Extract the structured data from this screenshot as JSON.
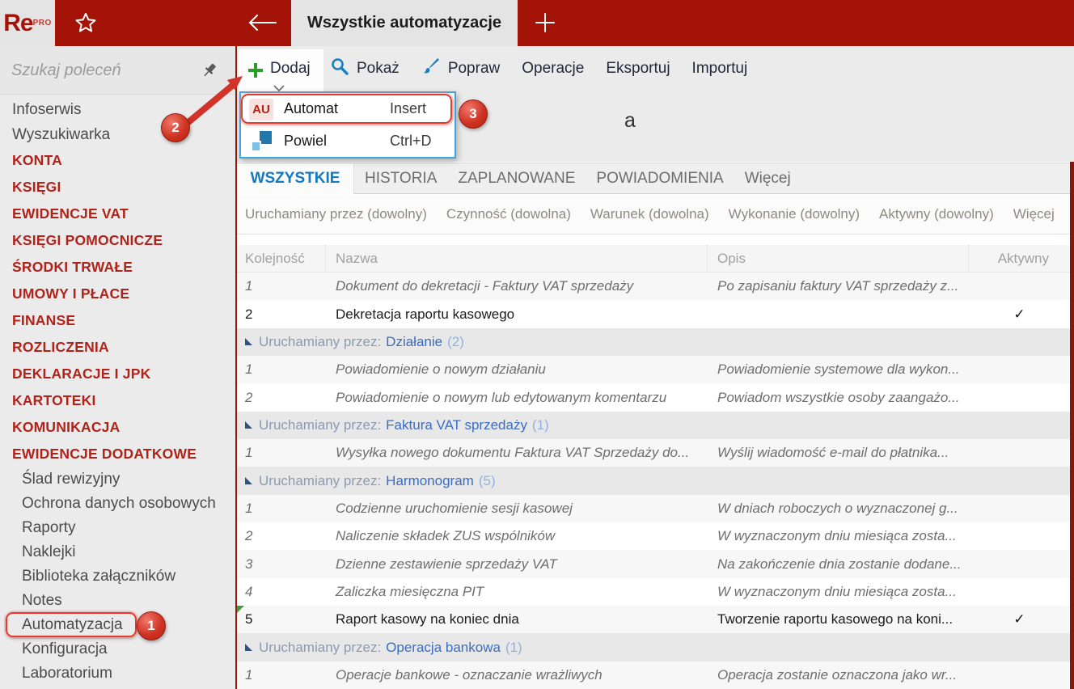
{
  "topbar": {
    "logo": "Re",
    "logo_sup": "PRO",
    "tab_title": "Wszystkie automatyzacje"
  },
  "sidebar": {
    "search_placeholder": "Szukaj poleceń",
    "items": [
      {
        "label": "Infoserwis",
        "type": "plain"
      },
      {
        "label": "Wyszukiwarka",
        "type": "plain"
      },
      {
        "label": "KONTA",
        "type": "section"
      },
      {
        "label": "KSIĘGI",
        "type": "section"
      },
      {
        "label": "EWIDENCJE VAT",
        "type": "section"
      },
      {
        "label": "KSIĘGI POMOCNICZE",
        "type": "section"
      },
      {
        "label": "ŚRODKI TRWAŁE",
        "type": "section"
      },
      {
        "label": "UMOWY I PŁACE",
        "type": "section"
      },
      {
        "label": "FINANSE",
        "type": "section"
      },
      {
        "label": "ROZLICZENIA",
        "type": "section"
      },
      {
        "label": "DEKLARACJE I JPK",
        "type": "section"
      },
      {
        "label": "KARTOTEKI",
        "type": "section"
      },
      {
        "label": "KOMUNIKACJA",
        "type": "section"
      },
      {
        "label": "EWIDENCJE DODATKOWE",
        "type": "section"
      },
      {
        "label": "Ślad rewizyjny",
        "type": "sub"
      },
      {
        "label": "Ochrona danych osobowych",
        "type": "sub"
      },
      {
        "label": "Raporty",
        "type": "sub"
      },
      {
        "label": "Naklejki",
        "type": "sub"
      },
      {
        "label": "Biblioteka załączników",
        "type": "sub"
      },
      {
        "label": "Notes",
        "type": "sub"
      },
      {
        "label": "Automatyzacja",
        "type": "sub"
      },
      {
        "label": "Konfiguracja",
        "type": "sub"
      },
      {
        "label": "Laboratorium",
        "type": "sub"
      }
    ]
  },
  "toolbar": {
    "add_label": "Dodaj",
    "show_label": "Pokaż",
    "edit_label": "Popraw",
    "operations_label": "Operacje",
    "export_label": "Eksportuj",
    "import_label": "Importuj"
  },
  "dropdown": {
    "items": [
      {
        "icon_text": "AU",
        "label": "Automat",
        "shortcut": "Insert"
      },
      {
        "icon_text": "",
        "label": "Powiel",
        "shortcut": "Ctrl+D"
      }
    ]
  },
  "partial_title": "a",
  "tabs": [
    "WSZYSTKIE",
    "HISTORIA",
    "ZAPLANOWANE",
    "POWIADOMIENIA",
    "Więcej"
  ],
  "filters": [
    "Uruchamiany przez (dowolny)",
    "Czynność (dowolna)",
    "Warunek (dowolna)",
    "Wykonanie (dowolny)",
    "Aktywny (dowolny)",
    "Więcej"
  ],
  "table": {
    "columns": [
      "Kolejność",
      "Nazwa",
      "Opis",
      "Aktywny"
    ],
    "rows": [
      {
        "type": "row",
        "seq": 1,
        "name": "Dokument do dekretacji - Faktury VAT sprzedaży",
        "desc": "Po zapisaniu faktury VAT sprzedaży z...",
        "active": "",
        "italic": true
      },
      {
        "type": "row",
        "seq": 2,
        "name": "Dekretacja raportu kasowego",
        "desc": "",
        "active": "✓",
        "italic": false
      },
      {
        "type": "group",
        "label": "Uruchamiany przez:",
        "value": "Działanie",
        "count": "(2)"
      },
      {
        "type": "row",
        "seq": 1,
        "name": "Powiadomienie o nowym działaniu",
        "desc": "Powiadomienie systemowe dla wykon...",
        "active": "",
        "italic": true
      },
      {
        "type": "row",
        "seq": 2,
        "name": "Powiadomienie o nowym lub edytowanym komentarzu",
        "desc": "Powiadom wszystkie osoby zaangażo...",
        "active": "",
        "italic": true
      },
      {
        "type": "group",
        "label": "Uruchamiany przez:",
        "value": "Faktura VAT sprzedaży",
        "count": "(1)"
      },
      {
        "type": "row",
        "seq": 1,
        "name": "Wysyłka nowego dokumentu Faktura VAT Sprzedaży do...",
        "desc": "Wyślij wiadomość e-mail do płatnika...",
        "active": "",
        "italic": true
      },
      {
        "type": "group",
        "label": "Uruchamiany przez:",
        "value": "Harmonogram",
        "count": "(5)"
      },
      {
        "type": "row",
        "seq": 1,
        "name": "Codzienne uruchomienie sesji kasowej",
        "desc": "W dniach roboczych o wyznaczonej g...",
        "active": "",
        "italic": true
      },
      {
        "type": "row",
        "seq": 2,
        "name": "Naliczenie składek ZUS wspólników",
        "desc": "W wyznaczonym dniu miesiąca zosta...",
        "active": "",
        "italic": true
      },
      {
        "type": "row",
        "seq": 3,
        "name": "Dzienne zestawienie sprzedaży VAT",
        "desc": "Na zakończenie dnia zostanie dodane...",
        "active": "",
        "italic": true
      },
      {
        "type": "row",
        "seq": 4,
        "name": "Zaliczka miesięczna PIT",
        "desc": "W wyznaczonym dniu miesiąca zosta...",
        "active": "",
        "italic": true
      },
      {
        "type": "row",
        "seq": 5,
        "name": "Raport kasowy na koniec dnia",
        "desc": "Tworzenie raportu kasowego na koni...",
        "active": "✓",
        "italic": false,
        "marker": true
      },
      {
        "type": "group",
        "label": "Uruchamiany przez:",
        "value": "Operacja bankowa",
        "count": "(1)"
      },
      {
        "type": "row",
        "seq": 1,
        "name": "Operacje bankowe - oznaczanie wrażliwych",
        "desc": "Operacja zostanie oznaczona jako wr...",
        "active": "",
        "italic": true
      }
    ]
  },
  "annotations": {
    "step1": "1",
    "step2": "2",
    "step3": "3"
  },
  "colors": {
    "brand_red": "#a31307",
    "annotation_red": "#e23c2c",
    "tab_active_blue": "#147ac0",
    "menu_border_blue": "#41a5dc",
    "group_value_blue": "#3a6dc0",
    "plus_green": "#2d9c2d"
  }
}
